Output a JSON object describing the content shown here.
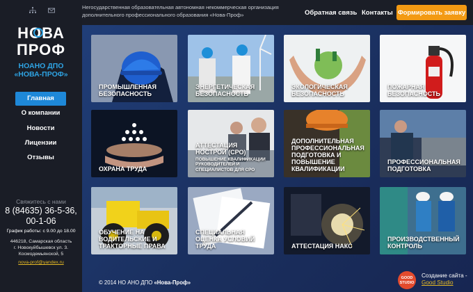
{
  "sidebar": {
    "icons": [
      "sitemap-icon",
      "mail-icon"
    ],
    "logo_line1": "НОВА",
    "logo_line2": "ПРОФ",
    "org_short_line1": "НОАНО ДПО",
    "org_short_line2": "«НОВА-ПРОФ»",
    "nav": [
      {
        "label": "Главная",
        "active": true
      },
      {
        "label": "О компании"
      },
      {
        "label": "Новости"
      },
      {
        "label": "Лицензии"
      },
      {
        "label": "Отзывы"
      }
    ],
    "contact_heading": "Свяжитесь с нами",
    "phone_line1": "8 (84635) 36-5-36,",
    "phone_line2": "00-1-06",
    "hours": "График работы: с 9.00 до 18.00",
    "address_line1": "446218, Самарская область",
    "address_line2": "г. Новокуйбышевск ул. 3.",
    "address_line3": "Космодемьянской, 5",
    "email": "nova-prof@yandex.ru"
  },
  "header": {
    "org_full": "Негосударственная образовательная автономная некоммерческая организация дополнительного профессионального образования «Нова-Проф»",
    "feedback": "Обратная связь",
    "contacts": "Контакты",
    "cta": "Формировать заявку"
  },
  "tiles": [
    {
      "label": "Промышленная безопасность"
    },
    {
      "label": "Энергетическая безопасность"
    },
    {
      "label": "Экологическая безопасность"
    },
    {
      "label": "Пожарная безопасность"
    },
    {
      "label": "Охрана труда"
    },
    {
      "label": "Аттестация НОСТРОЙ (СРО)",
      "sub": "Повышение квалификации руководителей и специалистов для СРО"
    },
    {
      "label": "Дополнительная профессиональная подготовка и повышение квалификации"
    },
    {
      "label": "Профессиональная подготовка"
    },
    {
      "label": "Обучение на водительские и тракторные права"
    },
    {
      "label": "Специальная оценка условий труда"
    },
    {
      "label": "Аттестация НАКС"
    },
    {
      "label": "Производственный контроль"
    }
  ],
  "footer": {
    "copyright_prefix": "© 2014 НО АНО ДПО ",
    "copyright_brand": "«Нова-Проф»",
    "badge": "GOOD STUDIO",
    "created_by": "Создание сайта -",
    "studio": "Good Studio"
  }
}
